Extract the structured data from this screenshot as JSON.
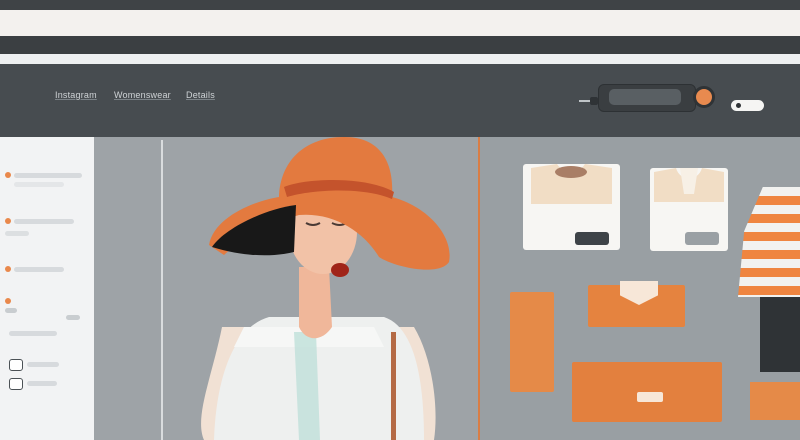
{
  "nav": {
    "items": [
      {
        "label": "Instagram"
      },
      {
        "label": "Womenswear"
      },
      {
        "label": "Details"
      }
    ]
  },
  "search": {
    "placeholder": ""
  },
  "colors": {
    "accent": "#e9884b",
    "header_bg": "#474c50",
    "sidebar_bg": "#f2f3f4",
    "hero_bg": "#9ea3a7"
  },
  "icons": [
    "search-button-icon",
    "user-login-icon"
  ]
}
